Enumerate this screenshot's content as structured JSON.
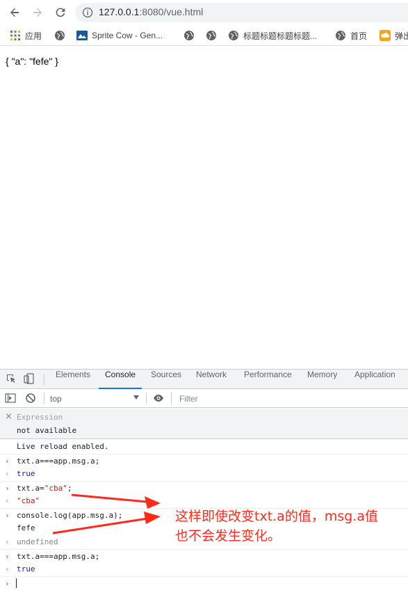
{
  "browser": {
    "url_host": "127.0.0.1",
    "url_rest": ":8080/vue.html",
    "bookmarks": [
      {
        "label": "应用",
        "icon": "apps-grid-icon"
      },
      {
        "label": "",
        "icon": "globe-icon"
      },
      {
        "label": "Sprite Cow - Gen...",
        "icon": "sprite-cow-icon"
      },
      {
        "label": "",
        "icon": "globe-icon"
      },
      {
        "label": "标题标题标题标题...",
        "icon": "globe-icon"
      },
      {
        "label": "首页",
        "icon": "globe-icon"
      },
      {
        "label": "弹出",
        "icon": "orange-cloud-icon"
      }
    ]
  },
  "page": {
    "output": "{ \"a\": \"fefe\" }"
  },
  "devtools": {
    "tabs": [
      "Elements",
      "Console",
      "Sources",
      "Network",
      "Performance",
      "Memory",
      "Application"
    ],
    "active_tab": "Console",
    "context": "top",
    "filter_placeholder": "Filter",
    "expression": {
      "label": "Expression",
      "value": "not available"
    },
    "console": {
      "live_reload": "Live reload enabled.",
      "cmd1": "txt.a===app.msg.a;",
      "res1": "true",
      "cmd2_prefix": "txt.a=",
      "cmd2_string": "\"cba\"",
      "cmd2_suffix": ";",
      "res2": "\"cba\"",
      "cmd3": "console.log(app.msg.a);",
      "log3": "fefe",
      "res3": "undefined",
      "cmd4": "txt.a===app.msg.a;",
      "res4": "true"
    }
  },
  "annotation": {
    "line1": "这样即使改变txt.a的值，msg.a值",
    "line2": "也不会发生变化。",
    "color": "#ff2a1a"
  }
}
